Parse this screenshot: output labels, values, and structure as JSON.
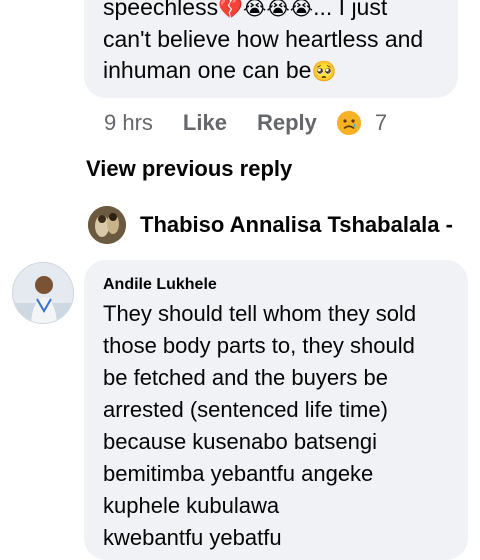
{
  "top_comment": {
    "line1_text": "speechless",
    "line1_suffix": "... I just",
    "line2": "can't believe how heartless and",
    "line3": "inhuman one can be",
    "emoji_broken_heart": "💔",
    "emoji_cry": "😭",
    "emoji_pleading": "🥺",
    "time": "9 hrs",
    "like_label": "Like",
    "reply_label": "Reply",
    "reaction_icon": "sad-face-icon",
    "reaction_count": "7"
  },
  "view_previous_reply": "View previous reply",
  "reply_preview": {
    "name": "Thabiso Annalisa Tshabalala -"
  },
  "comment": {
    "author": "Andile Lukhele",
    "lines": [
      "They should tell whom they sold",
      "those body parts to, they should",
      "be fetched and the buyers be",
      "arrested (sentenced life time)",
      "because kusenabo batsengi",
      "bemitimba yebantfu angeke",
      "kuphele kubulawa",
      "kwebantfu yebatfu"
    ]
  },
  "colors": {
    "bubble": "#f0f2f5",
    "meta": "#65676b",
    "text": "#050505",
    "reaction": "#f7b125"
  }
}
